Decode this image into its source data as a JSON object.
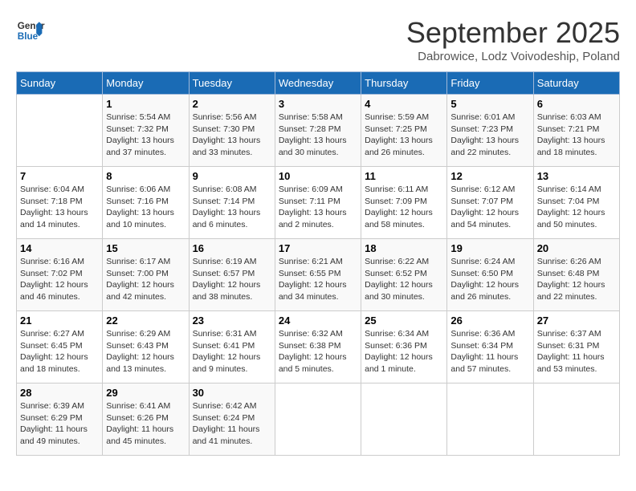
{
  "header": {
    "logo_line1": "General",
    "logo_line2": "Blue",
    "month": "September 2025",
    "location": "Dabrowice, Lodz Voivodeship, Poland"
  },
  "days_of_week": [
    "Sunday",
    "Monday",
    "Tuesday",
    "Wednesday",
    "Thursday",
    "Friday",
    "Saturday"
  ],
  "weeks": [
    [
      {
        "day": "",
        "info": ""
      },
      {
        "day": "1",
        "info": "Sunrise: 5:54 AM\nSunset: 7:32 PM\nDaylight: 13 hours\nand 37 minutes."
      },
      {
        "day": "2",
        "info": "Sunrise: 5:56 AM\nSunset: 7:30 PM\nDaylight: 13 hours\nand 33 minutes."
      },
      {
        "day": "3",
        "info": "Sunrise: 5:58 AM\nSunset: 7:28 PM\nDaylight: 13 hours\nand 30 minutes."
      },
      {
        "day": "4",
        "info": "Sunrise: 5:59 AM\nSunset: 7:25 PM\nDaylight: 13 hours\nand 26 minutes."
      },
      {
        "day": "5",
        "info": "Sunrise: 6:01 AM\nSunset: 7:23 PM\nDaylight: 13 hours\nand 22 minutes."
      },
      {
        "day": "6",
        "info": "Sunrise: 6:03 AM\nSunset: 7:21 PM\nDaylight: 13 hours\nand 18 minutes."
      }
    ],
    [
      {
        "day": "7",
        "info": "Sunrise: 6:04 AM\nSunset: 7:18 PM\nDaylight: 13 hours\nand 14 minutes."
      },
      {
        "day": "8",
        "info": "Sunrise: 6:06 AM\nSunset: 7:16 PM\nDaylight: 13 hours\nand 10 minutes."
      },
      {
        "day": "9",
        "info": "Sunrise: 6:08 AM\nSunset: 7:14 PM\nDaylight: 13 hours\nand 6 minutes."
      },
      {
        "day": "10",
        "info": "Sunrise: 6:09 AM\nSunset: 7:11 PM\nDaylight: 13 hours\nand 2 minutes."
      },
      {
        "day": "11",
        "info": "Sunrise: 6:11 AM\nSunset: 7:09 PM\nDaylight: 12 hours\nand 58 minutes."
      },
      {
        "day": "12",
        "info": "Sunrise: 6:12 AM\nSunset: 7:07 PM\nDaylight: 12 hours\nand 54 minutes."
      },
      {
        "day": "13",
        "info": "Sunrise: 6:14 AM\nSunset: 7:04 PM\nDaylight: 12 hours\nand 50 minutes."
      }
    ],
    [
      {
        "day": "14",
        "info": "Sunrise: 6:16 AM\nSunset: 7:02 PM\nDaylight: 12 hours\nand 46 minutes."
      },
      {
        "day": "15",
        "info": "Sunrise: 6:17 AM\nSunset: 7:00 PM\nDaylight: 12 hours\nand 42 minutes."
      },
      {
        "day": "16",
        "info": "Sunrise: 6:19 AM\nSunset: 6:57 PM\nDaylight: 12 hours\nand 38 minutes."
      },
      {
        "day": "17",
        "info": "Sunrise: 6:21 AM\nSunset: 6:55 PM\nDaylight: 12 hours\nand 34 minutes."
      },
      {
        "day": "18",
        "info": "Sunrise: 6:22 AM\nSunset: 6:52 PM\nDaylight: 12 hours\nand 30 minutes."
      },
      {
        "day": "19",
        "info": "Sunrise: 6:24 AM\nSunset: 6:50 PM\nDaylight: 12 hours\nand 26 minutes."
      },
      {
        "day": "20",
        "info": "Sunrise: 6:26 AM\nSunset: 6:48 PM\nDaylight: 12 hours\nand 22 minutes."
      }
    ],
    [
      {
        "day": "21",
        "info": "Sunrise: 6:27 AM\nSunset: 6:45 PM\nDaylight: 12 hours\nand 18 minutes."
      },
      {
        "day": "22",
        "info": "Sunrise: 6:29 AM\nSunset: 6:43 PM\nDaylight: 12 hours\nand 13 minutes."
      },
      {
        "day": "23",
        "info": "Sunrise: 6:31 AM\nSunset: 6:41 PM\nDaylight: 12 hours\nand 9 minutes."
      },
      {
        "day": "24",
        "info": "Sunrise: 6:32 AM\nSunset: 6:38 PM\nDaylight: 12 hours\nand 5 minutes."
      },
      {
        "day": "25",
        "info": "Sunrise: 6:34 AM\nSunset: 6:36 PM\nDaylight: 12 hours\nand 1 minute."
      },
      {
        "day": "26",
        "info": "Sunrise: 6:36 AM\nSunset: 6:34 PM\nDaylight: 11 hours\nand 57 minutes."
      },
      {
        "day": "27",
        "info": "Sunrise: 6:37 AM\nSunset: 6:31 PM\nDaylight: 11 hours\nand 53 minutes."
      }
    ],
    [
      {
        "day": "28",
        "info": "Sunrise: 6:39 AM\nSunset: 6:29 PM\nDaylight: 11 hours\nand 49 minutes."
      },
      {
        "day": "29",
        "info": "Sunrise: 6:41 AM\nSunset: 6:26 PM\nDaylight: 11 hours\nand 45 minutes."
      },
      {
        "day": "30",
        "info": "Sunrise: 6:42 AM\nSunset: 6:24 PM\nDaylight: 11 hours\nand 41 minutes."
      },
      {
        "day": "",
        "info": ""
      },
      {
        "day": "",
        "info": ""
      },
      {
        "day": "",
        "info": ""
      },
      {
        "day": "",
        "info": ""
      }
    ]
  ]
}
